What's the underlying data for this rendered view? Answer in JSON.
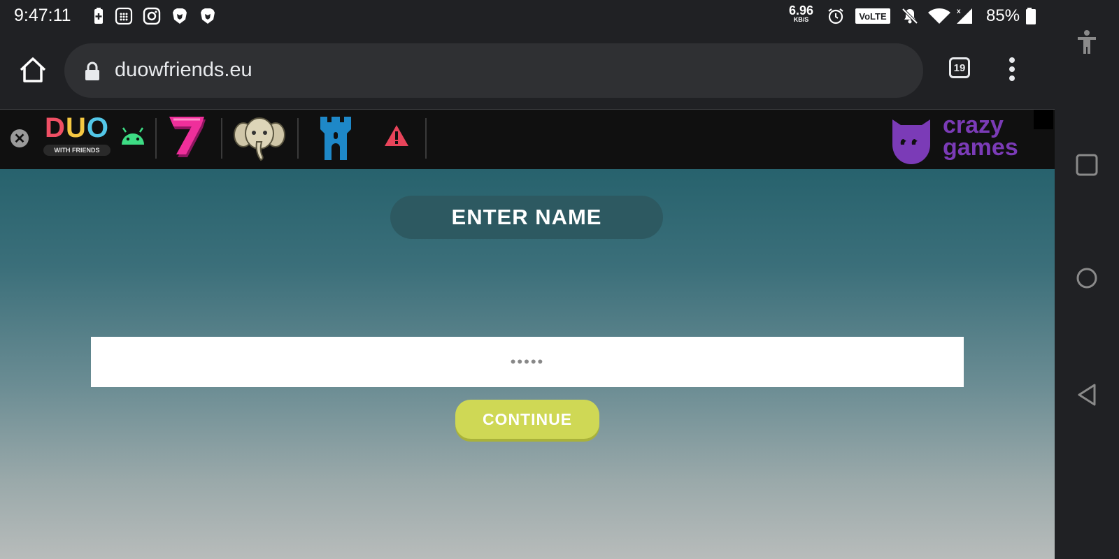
{
  "status_bar": {
    "time": "9:47:11",
    "net_speed_value": "6.96",
    "net_speed_unit": "KB/S",
    "volte": "VoLTE",
    "battery_percent": "85%",
    "icons": [
      "battery-saver-icon",
      "calculator-icon",
      "instagram-icon",
      "brave-icon",
      "brave-icon",
      "alarm-icon",
      "volte-icon",
      "mute-icon",
      "wifi-icon",
      "signal-icon",
      "battery-icon"
    ]
  },
  "browser": {
    "url": "duowfriends.eu",
    "tab_count": "19"
  },
  "site_nav": {
    "close_label": "✕",
    "logo_letters": [
      "D",
      "U",
      "O"
    ],
    "logo_colors": [
      "#ef4f64",
      "#f5c842",
      "#53c7e8"
    ],
    "logo_subtitle": "WITH FRIENDS",
    "crazy_games_line1": "crazy",
    "crazy_games_line2": "games",
    "icons": [
      "android-icon",
      "slot-seven-icon",
      "elephant-icon",
      "castle-tower-icon",
      "warning-icon"
    ]
  },
  "game": {
    "title": "ENTER NAME",
    "name_placeholder": "•••••",
    "continue_label": "CONTINUE"
  },
  "colors": {
    "accent_button": "#cfd855",
    "crazy_purple": "#7b3bb7",
    "title_pill": "#2d5961"
  }
}
